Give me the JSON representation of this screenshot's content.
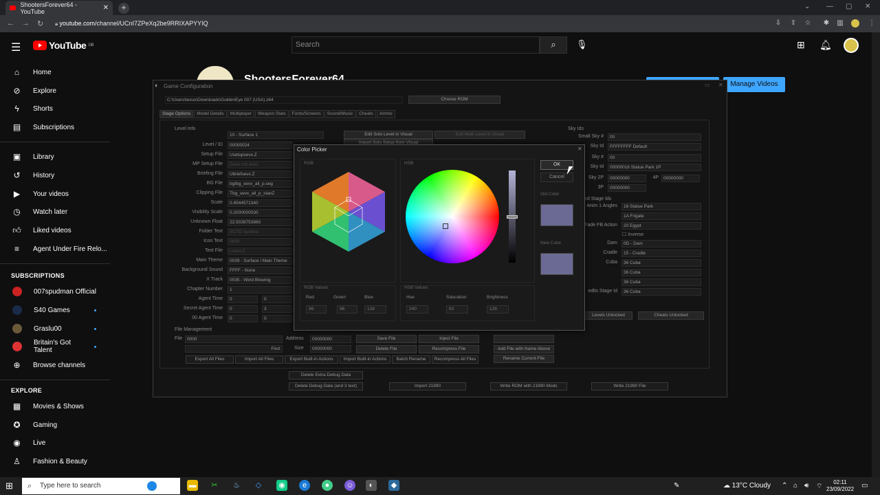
{
  "browser": {
    "tab_title": "ShootersForever64 - YouTube",
    "url_host": "youtube.com",
    "url_path": "/channel/UCnI7ZPeXq2be9RRIXAPYYIQ"
  },
  "youtube": {
    "logo": "YouTube",
    "region": "GB",
    "search_placeholder": "Search",
    "channel_name": "ShootersForever64",
    "manage_videos": "Manage Videos"
  },
  "sidebar": {
    "main": [
      "Home",
      "Explore",
      "Shorts",
      "Subscriptions"
    ],
    "library": [
      "Library",
      "History",
      "Your videos",
      "Watch later",
      "Liked videos",
      "Agent Under Fire Relo..."
    ],
    "subscriptions_header": "SUBSCRIPTIONS",
    "subscriptions": [
      "007spudman Official",
      "S40 Games",
      "Graslu00",
      "Britain's Got Talent",
      "Browse channels"
    ],
    "explore_header": "EXPLORE",
    "explore": [
      "Movies & Shows",
      "Gaming",
      "Live",
      "Fashion & Beauty"
    ]
  },
  "game_config": {
    "title": "Game Configuration",
    "rom_path": "C:\\Users\\lexus\\Downloads\\GoldenEye 007 (USA).z64",
    "choose_rom": "Choose ROM",
    "tabs": [
      "Stage Options",
      "Model Details",
      "Multiplayer",
      "Weapon Stats",
      "Fonts/Screens",
      "Sound/Music",
      "Cheats",
      "Ammo"
    ],
    "level_info_header": "Level Info",
    "level_select": "10 - Surface 1",
    "fields": [
      {
        "label": "Level / ID",
        "value": "00000024"
      },
      {
        "label": "Setup File",
        "value": "Usetupsevx.Z"
      },
      {
        "label": "MP Setup File",
        "value": "Does not exist"
      },
      {
        "label": "Briefing File",
        "value": "Ubriefsevx.Z"
      },
      {
        "label": "BG File",
        "value": "bg/bg_sevx_all_p.seg"
      },
      {
        "label": "Clipping File",
        "value": "Tbg_sevx_all_p_stanZ"
      },
      {
        "label": "Scale",
        "value": "0.4544571340"
      },
      {
        "label": "Visibility Scale",
        "value": "0.2000000030"
      },
      {
        "label": "Unknown Float",
        "value": "22.5039753960"
      },
      {
        "label": "Folder Text",
        "value": "SCTD Surface"
      },
      {
        "label": "Icon Text",
        "value": "0000"
      },
      {
        "label": "Text File",
        "value": "Lsevx.Z"
      },
      {
        "label": "Main Theme",
        "value": "0039 - Surface i Main Theme"
      },
      {
        "label": "Background Sound",
        "value": "FFFF - None"
      },
      {
        "label": "X Track",
        "value": "0035 - Wind Blowing"
      },
      {
        "label": "Chapter Number",
        "value": "1"
      },
      {
        "label": "Agent Time",
        "value": "0"
      },
      {
        "label": "Secret Agent Time",
        "value": "0"
      },
      {
        "label": "00 Agent Time",
        "value": "0"
      }
    ],
    "time_secondary": [
      "0",
      "3",
      "0"
    ],
    "edit_solo_visual": "Edit Solo Level in Visual",
    "import_solo_visual": "Import Solo Setup from Visual",
    "edit_multi_visual": "Edit Multi Level in Visual",
    "sky_ids_header": "Sky Ids",
    "sky_fields": [
      {
        "label": "Small Sky #",
        "value": "00"
      },
      {
        "label": "Sky Id",
        "value": "FFFFFFFF Default"
      },
      {
        "label": "Sky #",
        "value": "00"
      },
      {
        "label": "Sky Id",
        "value": "00000016 Statue Park 1P"
      },
      {
        "label": "Sky 2P",
        "value": "00000000"
      },
      {
        "label": "4P",
        "value": "00000000"
      },
      {
        "label": "3P",
        "value": "00000000"
      }
    ],
    "stage_ids_header": "ed Stage Ids",
    "stage_fields": [
      {
        "label": "Anim 1 Angles",
        "value": "16 Statue Park"
      },
      {
        "label": "",
        "value": "1A Frigate"
      },
      {
        "label": "Fade FB Action",
        "value": "20 Egypt"
      },
      {
        "label": "Dam",
        "value": "0D - Dam"
      },
      {
        "label": "Cradle",
        "value": "15 - Cradle"
      },
      {
        "label": "Cuba",
        "value": "36 Cuba"
      },
      {
        "label": "",
        "value": "36 Cuba"
      },
      {
        "label": "",
        "value": "36 Cuba"
      },
      {
        "label": "edits Stage Id",
        "value": "36 Cuba"
      }
    ],
    "inverse": "Inverse",
    "levels_unlocked": "Levels Unlocked",
    "cheats_unlocked": "Cheats Unlocked",
    "file_mgmt_header": "File Management",
    "file_label": "File",
    "file_value": "0000",
    "address_label": "Address",
    "address_value": "00000000",
    "size_label": "Size",
    "size_value": "00000000",
    "find": "Find",
    "buttons": {
      "save_file": "Save File",
      "inject_file": "Inject File",
      "delete_file": "Delete File",
      "recompress_file": "Recompress File",
      "add_file_name": "Add File with Name Above",
      "rename_file": "Rename Current File",
      "export_all": "Export All Files",
      "import_all": "Import All Files",
      "export_builtin": "Export Built-in Actions",
      "import_builtin": "Import Built-in Actions",
      "batch_rename": "Batch Rename",
      "recompress_all": "Recompress All Files",
      "delete_extra_debug": "Delete Extra Debug Data",
      "delete_debug": "Delete Debug Data (and 3 text)",
      "import_21990": "Import 21990",
      "write_rom_21990": "Write ROM with 21990 Mods",
      "write_21990": "Write 21990 File"
    }
  },
  "color_picker": {
    "title": "Color Picker",
    "rgb_header": "RGB",
    "hsb_header": "HSB",
    "ok": "OK",
    "cancel": "Cancel",
    "old_color_label": "Old Color",
    "new_color_label": "New Color",
    "old_color": "#6a6a94",
    "new_color": "#6a6a94",
    "rgb_values_header": "RGB Values",
    "hsb_values_header": "HSB Values",
    "red_label": "Red",
    "red": "96",
    "green_label": "Green",
    "green": "96",
    "blue_label": "Blue",
    "blue": "128",
    "hue_label": "Hue",
    "hue": "240",
    "saturation_label": "Saturation",
    "saturation": "63",
    "brightness_label": "Brightness",
    "brightness": "128"
  },
  "taskbar": {
    "search_placeholder": "Type here to search",
    "weather": "13°C  Cloudy",
    "time": "02:11",
    "date": "23/09/2022"
  }
}
